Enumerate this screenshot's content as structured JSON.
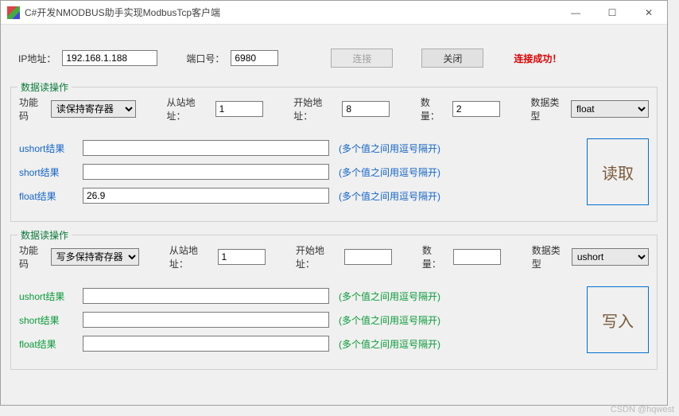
{
  "title": "C#开发NMODBUS助手实现ModbusTcp客户端",
  "connection": {
    "ip_label": "IP地址：",
    "ip_value": "192.168.1.188",
    "port_label": "端口号：",
    "port_value": "6980",
    "connect_label": "连接",
    "close_label": "关闭",
    "status": "连接成功！"
  },
  "read": {
    "legend": "数据读操作",
    "func_label": "功能码",
    "func_value": "读保持寄存器",
    "slave_label": "从站地址：",
    "slave_value": "1",
    "start_label": "开始地址：",
    "start_value": "8",
    "qty_label": "数量：",
    "qty_value": "2",
    "dtype_label": "数据类型",
    "dtype_value": "float",
    "ushort_label": "ushort结果",
    "ushort_value": "",
    "short_label": "short结果",
    "short_value": "",
    "float_label": "float结果",
    "float_value": "26.9",
    "hint": "(多个值之间用逗号隔开)",
    "button": "读取"
  },
  "write": {
    "legend": "数据读操作",
    "func_label": "功能码",
    "func_value": "写多保持寄存器",
    "slave_label": "从站地址：",
    "slave_value": "1",
    "start_label": "开始地址：",
    "start_value": "",
    "qty_label": "数量：",
    "qty_value": "",
    "dtype_label": "数据类型",
    "dtype_value": "ushort",
    "ushort_label": "ushort结果",
    "ushort_value": "",
    "short_label": "short结果",
    "short_value": "",
    "float_label": "float结果",
    "float_value": "",
    "hint": "(多个值之间用逗号隔开)",
    "button": "写入"
  },
  "watermark": "CSDN @hqwest"
}
